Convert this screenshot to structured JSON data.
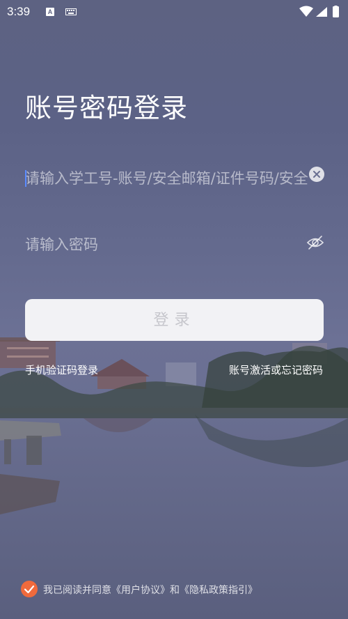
{
  "status_bar": {
    "time": "3:39",
    "notification_letter": "A"
  },
  "title": "账号密码登录",
  "account_field": {
    "placeholder": "请输入学工号-账号/安全邮箱/证件号码/安全"
  },
  "password_field": {
    "placeholder": "请输入密码"
  },
  "login_button": "登录",
  "links": {
    "sms_login": "手机验证码登录",
    "activate_or_forgot": "账号激活或忘记密码"
  },
  "agreement": {
    "checked": true,
    "text": "我已阅读并同意《用户协议》和《隐私政策指引》"
  },
  "colors": {
    "accent_check": "#f06a3c",
    "caret": "#5b8cff",
    "button_bg": "#f2f2f5"
  }
}
